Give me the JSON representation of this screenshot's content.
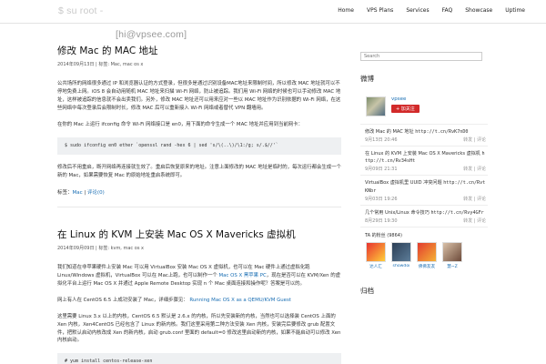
{
  "header": {
    "logo_main": "[hi@vpsee.com]",
    "logo_suffix": "$ su root -",
    "nav": [
      "Home",
      "VPS Plans",
      "Services",
      "FAQ",
      "Showcase",
      "Uptime"
    ]
  },
  "posts": [
    {
      "title": "修改 Mac 的 MAC 地址",
      "meta": "2014年09月13日 | 标签: Mac, mac os x",
      "paragraphs": [
        "公共场所的网络很多通过 IP 和浏览器认证的方式登录，但很多是通过识别设备MAC地址来限制时间，所以修改 MAC 地址就可以不停地免费上网。iOS 8 会自动用随机 MAC 地址来扫描 Wi-Fi 网络，防止被追踪。我们用 Wi-Fi 网络的时候也可以手动修改 MAC 地址，这样被追踪的信息就不会出卖我们。另外，修改 MAC 地址还可以用来应对一些以 MAC 地址作为识别依据的 Wi-Fi 网络，在这些网络中每次登录后会限制时长，修改 MAC 后可以重新接入 Wi-Fi 网络或者替代 VPN 翻墙用。",
        "在你的 Mac 上运行 ifconfig 命令 Wi-Fi 网络接口是 en0，用下面的命令生成一个 MAC 地址并应用到当前网卡："
      ],
      "code": "$ sudo ifconfig en0 ether `openssl rand -hex 6 | sed 's/\\(..\\)/\\1:/g; s/.$//'`",
      "after": "修改后不用重启，断开网络再连接就生效了。重启后恢复原来的地址。注意上面修改的 MAC 地址是临时的，每次运行都会生成一个新的 Mac，如果需要恢复 Mac 的原始地址重启系统即可。",
      "tags_label": "标签：",
      "tags_link": "Mac",
      "comments": "评论(0)"
    },
    {
      "title": "在 Linux 的 KVM 上安装 Mac OS X Mavericks 虚拟机",
      "meta": "2014年09月09日 | 标签: kvm, mac os x",
      "paragraphs": [
        "我们知道在非苹果硬件上安装 Mac 可以用 VirtualBox 安装 Mac OS X 虚拟机，也可以在 Mac 硬件上通过虚拟化跑 Linux/Windows 虚拟机，VirtualBox 可以在 Mac上跑，也可以制作一个",
        "，现在是否可以在 KVM/Xen 的虚拟化平台上运行 Mac OS X 并通过 Apple Remote Desktop 实现 n 个 Mac 桌面连接和操作呢？答案是可以的。",
        "网上有人在 CentOS 6.5 上成功安装了 Mac，详细步骤见：",
        "这里需要 Linux 3.x 以上的内核，CentOS 6.5 默认是 2.6.x 的内核，所以先安装新的内核，当然也可以选择装 CentOS 上面的 Xen 内核，Xen4CentOS 已经包含了 Linux 的新内核。我们这里采用第二种方法安装 Xen 内核，安装完后要修改 grub 配置文件，把默认启动内核改成 Xen 的新内核，启动 grub.conf 里面的 default=0 修改这里启动新的内核，如果不能启动可以修改 Xen 内核启动。"
      ],
      "inline_link_1": "Mac OS X 黑苹果 PC",
      "inline_link_2": "Running Mac OS X as a QEMU/KVM Guest",
      "code": "# yum install centos-release-xen\n# yum update"
    }
  ],
  "sidebar": {
    "search_placeholder": "Search",
    "weibo_title": "微博",
    "weibo_name": "vpsee",
    "follow_label": "+ 加关注",
    "feed": [
      {
        "text": "修改 Mac 的 MAC 地址 ",
        "url": "http://t.cn/RvK7nD0",
        "time": "9月13日 20:46",
        "acts": "转发 | 评论"
      },
      {
        "text": "在 Linux 的 KVM 上安装 Mac OS X Mavericks 虚拟机 ",
        "url": "http://t.cn/Rv34sHt",
        "time": "9月09日 21:31",
        "acts": "转发 | 评论"
      },
      {
        "text": "VirtualBox 虚拟机里 UUID 冲突问题 ",
        "url": "http://t.cn/RvtKNbr",
        "time": "9月03日 19:26",
        "acts": "转发 | 评论"
      },
      {
        "text": "几个常用 Unix/Linux 命令技巧 ",
        "url": "http://t.cn/Rvy4GFr",
        "time": "8月29日 19:30",
        "acts": "转发 | 评论"
      }
    ],
    "fans_label": "TA 的粉丝 (9864)",
    "fans": [
      {
        "name": "达人汇",
        "color1": "#e8322f",
        "color2": "#ffcf3a"
      },
      {
        "name": "showdoi",
        "color1": "#2b3e55",
        "color2": "#5d7d99"
      },
      {
        "name": "佛佛友友",
        "color1": "#e23b2e",
        "color2": "#f5b236"
      },
      {
        "name": "慧~Z",
        "color1": "#d9c1a8",
        "color2": "#6d4a3a"
      }
    ],
    "second_title": "归档"
  }
}
